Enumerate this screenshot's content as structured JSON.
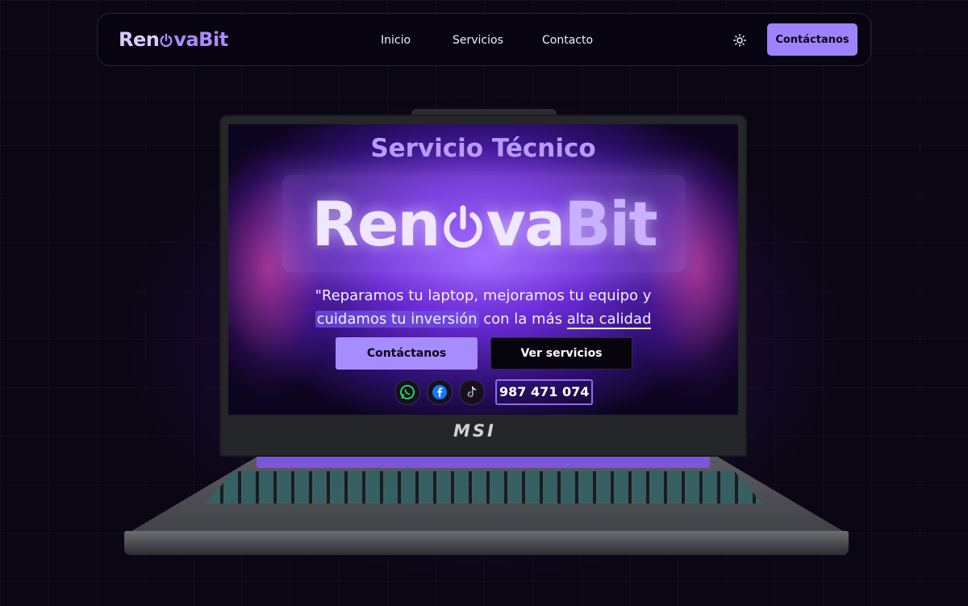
{
  "navbar": {
    "logo": {
      "part1": "Ren",
      "part2": "vaBit"
    },
    "links": [
      "Inicio",
      "Servicios",
      "Contacto"
    ],
    "theme_icon": "sun-icon",
    "cta_label": "Contáctanos"
  },
  "hero": {
    "title": "Servicio Técnico",
    "brand": {
      "part1": "Ren",
      "part2": "va",
      "part3": "Bit"
    },
    "tagline": {
      "line1": "\"Reparamos tu laptop, mejoramos tu equipo y",
      "highlight": "cuidamos tu inversión",
      "middle": " con la más ",
      "underlined": "alta calidad"
    },
    "primary_button": "Contáctanos",
    "secondary_button": "Ver servicios",
    "social_icons": [
      "whatsapp-icon",
      "facebook-icon",
      "tiktok-icon"
    ],
    "phone": "987 471 074"
  },
  "laptop": {
    "brand": "MSI"
  },
  "colors": {
    "accent": "#9d83ff",
    "background": "#0b0614"
  }
}
